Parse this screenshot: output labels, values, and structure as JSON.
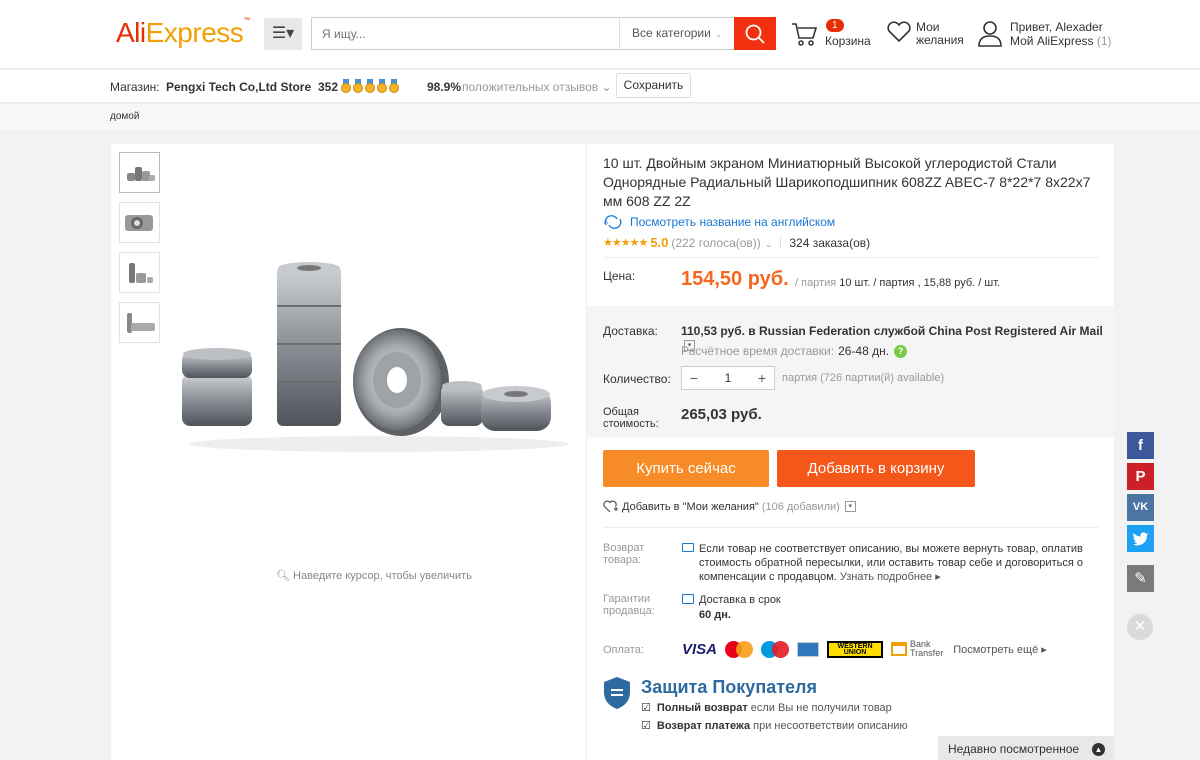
{
  "header": {
    "logo_ali": "Ali",
    "logo_express": "Express",
    "logo_tm": "™",
    "search_placeholder": "Я ищу...",
    "search_category": "Все категории",
    "cart_count": "1",
    "cart_label": "Корзина",
    "wishlist_label_1": "Мои",
    "wishlist_label_2": "желания",
    "greeting": "Привет, Alexader",
    "my_account": "Мой AliExpress",
    "my_account_count": "(1)"
  },
  "store": {
    "label": "Магазин:",
    "name": "Pengxi Tech Co,Ltd Store",
    "score": "352",
    "medal_count": 5,
    "positive_pct": "98.9%",
    "feedback_label": "положительных отзывов",
    "save_label": "Сохранить"
  },
  "breadcrumb": {
    "home": "домой"
  },
  "gallery": {
    "thumbnail_count": 4,
    "zoom_hint": "Наведите курсор, чтобы увеличить"
  },
  "product": {
    "title": "10 шт. Двойным экраном Миниатюрный Высокой углеродистой Стали Однорядные Радиальный Шарикоподшипник 608ZZ ABEC-7 8*22*7 8x22x7 мм 608 ZZ 2Z",
    "translate_link": "Посмотреть название на английском",
    "stars": "★★★★★",
    "rating": "5.0",
    "votes": "(222 голоса(ов))",
    "orders": "324 заказа(ов)",
    "price_label": "Цена:",
    "price": "154,50 руб.",
    "price_unit_prefix": "/ партия",
    "price_unit_detail": "10 шт. / партия , 15,88 руб. / шт."
  },
  "delivery": {
    "label": "Доставка:",
    "value": "110,53 руб. в Russian Federation службой China Post Registered Air Mail",
    "time_label": "Расчётное время доставки:",
    "time_value": "26-48 дн.",
    "qty_label": "Количество:",
    "qty_minus": "−",
    "qty_value": "1",
    "qty_plus": "+",
    "qty_note": "партия (726 партии(й) available)",
    "total_label": "Общая стоимость:",
    "total_value": "265,03 руб."
  },
  "actions": {
    "buy_now": "Купить сейчас",
    "add_to_cart": "Добавить в корзину",
    "add_wishlist": "Добавить в \"Мои желания\"",
    "wishlist_count": "(106 добавили)"
  },
  "return": {
    "label": "Возврат товара:",
    "text": "Если товар не соответствует описанию, вы можете вернуть товар, оплатив стоимость обратной пересылки, или оставить товар себе и договориться о компенсации с продавцом.",
    "more": "Узнать подробнее ▸"
  },
  "guarantee": {
    "label": "Гарантии продавца:",
    "line1": "Доставка в срок",
    "line2": "60 дн."
  },
  "payment": {
    "label": "Оплата:",
    "visa": "VISA",
    "wu_line1": "WESTERN",
    "wu_line2": "UNION",
    "bank_line1": "Bank",
    "bank_line2": "Transfer",
    "see_more": "Посмотреть ещё ▸"
  },
  "protection": {
    "title": "Защита Покупателя",
    "item1_bold": "Полный возврат",
    "item1_rest": " если Вы не получили товар",
    "item2_bold": "Возврат платежа",
    "item2_rest": " при несоответствии описанию"
  },
  "social": {
    "facebook": "f",
    "pinterest": "P",
    "vk": "VK",
    "edit": "✎",
    "close": "✕"
  },
  "recently_viewed": "Недавно посмотренное",
  "colors": {
    "accent_orange": "#f5571a",
    "buy_orange": "#f78b27",
    "price_orange": "#f5671f",
    "link_blue": "#1976d2",
    "facebook": "#3b5998",
    "pinterest": "#cb2027",
    "vk": "#4c75a3",
    "twitter": "#1da1f2"
  }
}
